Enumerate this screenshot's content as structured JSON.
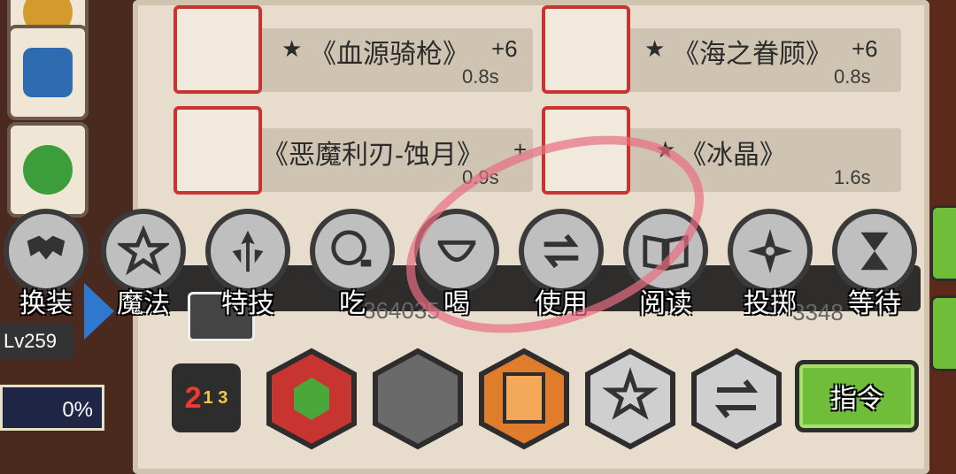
{
  "items": [
    {
      "star": "★",
      "name": "《血源骑枪》",
      "plus": "+6",
      "time": "0.8s"
    },
    {
      "star": "★",
      "name": "《海之眷顾》",
      "plus": "+6",
      "time": "0.8s"
    },
    {
      "star": "",
      "name": "《恶魔利刃-蚀月》",
      "plus": "+",
      "time": "0.9s"
    },
    {
      "star": "★",
      "name": "《冰晶》",
      "plus": "",
      "time": "1.6s"
    }
  ],
  "actions": [
    {
      "label": "换装",
      "icon": "armor-icon"
    },
    {
      "label": "魔法",
      "icon": "star-icon"
    },
    {
      "label": "特技",
      "icon": "skill-icon"
    },
    {
      "label": "吃",
      "icon": "eat-icon"
    },
    {
      "label": "喝",
      "icon": "drink-icon"
    },
    {
      "label": "使用",
      "icon": "swap-arrows-icon"
    },
    {
      "label": "阅读",
      "icon": "book-icon"
    },
    {
      "label": "投掷",
      "icon": "shuriken-icon"
    },
    {
      "label": "等待",
      "icon": "hourglass-icon"
    }
  ],
  "strip_values": {
    "gold": "364035",
    "other": "3348"
  },
  "player": {
    "level": "Lv259",
    "progress": "0%"
  },
  "bottom": {
    "score_main": "2",
    "score_sub": "1 3",
    "command_label": "指令"
  },
  "colors": {
    "accent_green": "#6fbd39",
    "highlight_ring": "#e86e82",
    "rarity_red": "#c8342f"
  }
}
